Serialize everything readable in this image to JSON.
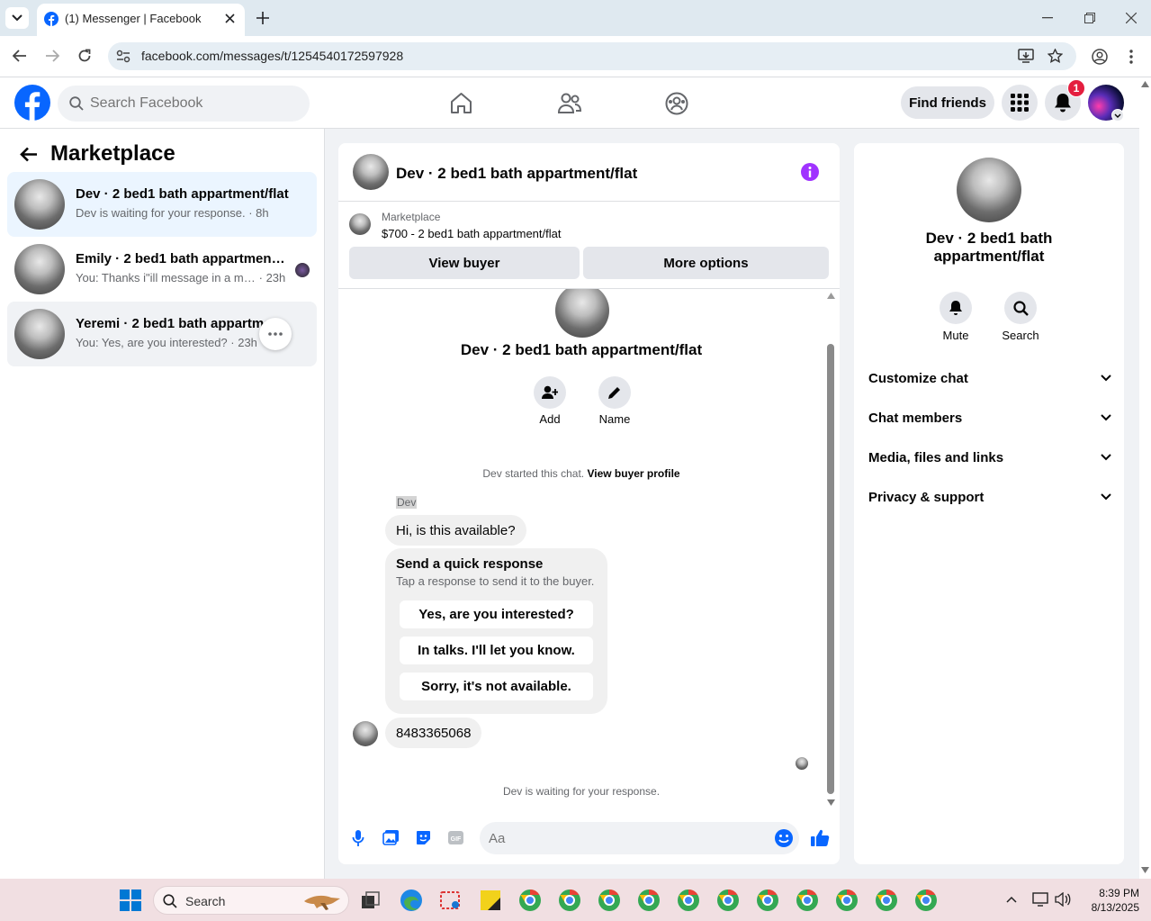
{
  "browser": {
    "tab_title": "(1) Messenger | Facebook",
    "url": "facebook.com/messages/t/1254540172597928"
  },
  "header": {
    "search_placeholder": "Search Facebook",
    "find_friends": "Find friends",
    "notification_count": "1"
  },
  "sidebar": {
    "title": "Marketplace",
    "conversations": [
      {
        "title": "Dev · 2 bed1 bath appartment/flat",
        "preview": "Dev is waiting for your response.",
        "time": "8h"
      },
      {
        "title": "Emily · 2 bed1 bath appartment/...",
        "preview": "You: Thanks i\"ill message in a mo...",
        "time": "23h"
      },
      {
        "title": "Yeremi · 2 bed1 bath appartme...",
        "preview": "You: Yes, are you interested?",
        "time": "23h"
      }
    ]
  },
  "chat": {
    "title": "Dev · 2 bed1 bath appartment/flat",
    "listing_source": "Marketplace",
    "listing_price": "$700 - 2 bed1 bath appartment/flat",
    "view_buyer": "View buyer",
    "more_options": "More options",
    "profile_name": "Dev · 2 bed1 bath appartment/flat",
    "add_label": "Add",
    "name_label": "Name",
    "started_text": "Dev started this chat.",
    "view_buyer_profile": "View buyer profile",
    "sender_name": "Dev",
    "message1": "Hi, is this available?",
    "quick_title": "Send a quick response",
    "quick_sub": "Tap a response to send it to the buyer.",
    "quick_replies": [
      "Yes, are you interested?",
      "In talks. I'll let you know.",
      "Sorry, it's not available."
    ],
    "message2": "8483365068",
    "waiting": "Dev is waiting for your response.",
    "composer_placeholder": "Aa"
  },
  "details": {
    "name": "Dev · 2 bed1 bath appartment/flat",
    "mute": "Mute",
    "search": "Search",
    "sections": [
      "Customize chat",
      "Chat members",
      "Media, files and links",
      "Privacy & support"
    ]
  },
  "taskbar": {
    "search": "Search",
    "time": "8:39 PM",
    "date": "8/13/2025"
  },
  "colors": {
    "fb_blue": "#0866ff",
    "accent_purple": "#a033ff",
    "badge_red": "#e41e3f",
    "selected_conv": "#ebf5ff"
  }
}
